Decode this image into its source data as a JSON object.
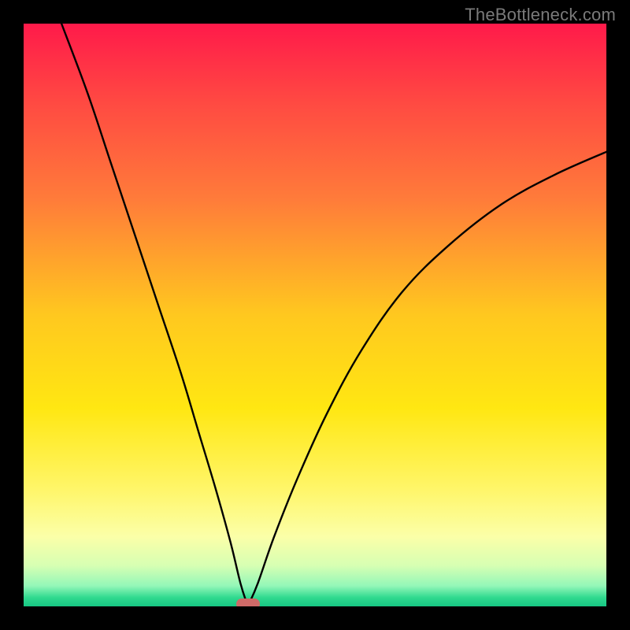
{
  "watermark": "TheBottleneck.com",
  "chart_data": {
    "type": "line",
    "title": "",
    "xlabel": "",
    "ylabel": "",
    "xlim": [
      0,
      100
    ],
    "ylim": [
      0,
      100
    ],
    "grid": false,
    "legend": false,
    "marker": {
      "x": 38.5,
      "width_pct": 4.0,
      "color": "#cf6a68"
    },
    "gradient_stops": [
      {
        "pct": 0,
        "color": "#ff1a4a"
      },
      {
        "pct": 14,
        "color": "#ff4b42"
      },
      {
        "pct": 30,
        "color": "#ff7b3a"
      },
      {
        "pct": 50,
        "color": "#ffc81f"
      },
      {
        "pct": 66,
        "color": "#ffe712"
      },
      {
        "pct": 80,
        "color": "#fff66a"
      },
      {
        "pct": 88,
        "color": "#fbffa8"
      },
      {
        "pct": 93,
        "color": "#d7ffb3"
      },
      {
        "pct": 96.5,
        "color": "#93f7b8"
      },
      {
        "pct": 98.5,
        "color": "#2fd98f"
      },
      {
        "pct": 100,
        "color": "#17c784"
      }
    ],
    "series": [
      {
        "name": "left-branch",
        "x": [
          6.5,
          11,
          15,
          19,
          23,
          27,
          30,
          33,
          35.5,
          37.2,
          38.3
        ],
        "y": [
          100,
          88,
          76,
          64,
          52,
          40,
          30,
          20,
          11,
          4,
          0.5
        ]
      },
      {
        "name": "right-branch",
        "x": [
          38.7,
          40.2,
          43,
          47,
          52,
          58,
          65,
          73,
          82,
          91,
          100
        ],
        "y": [
          0.5,
          4,
          12,
          22,
          33,
          44,
          54,
          62,
          69,
          74,
          78
        ]
      }
    ]
  }
}
